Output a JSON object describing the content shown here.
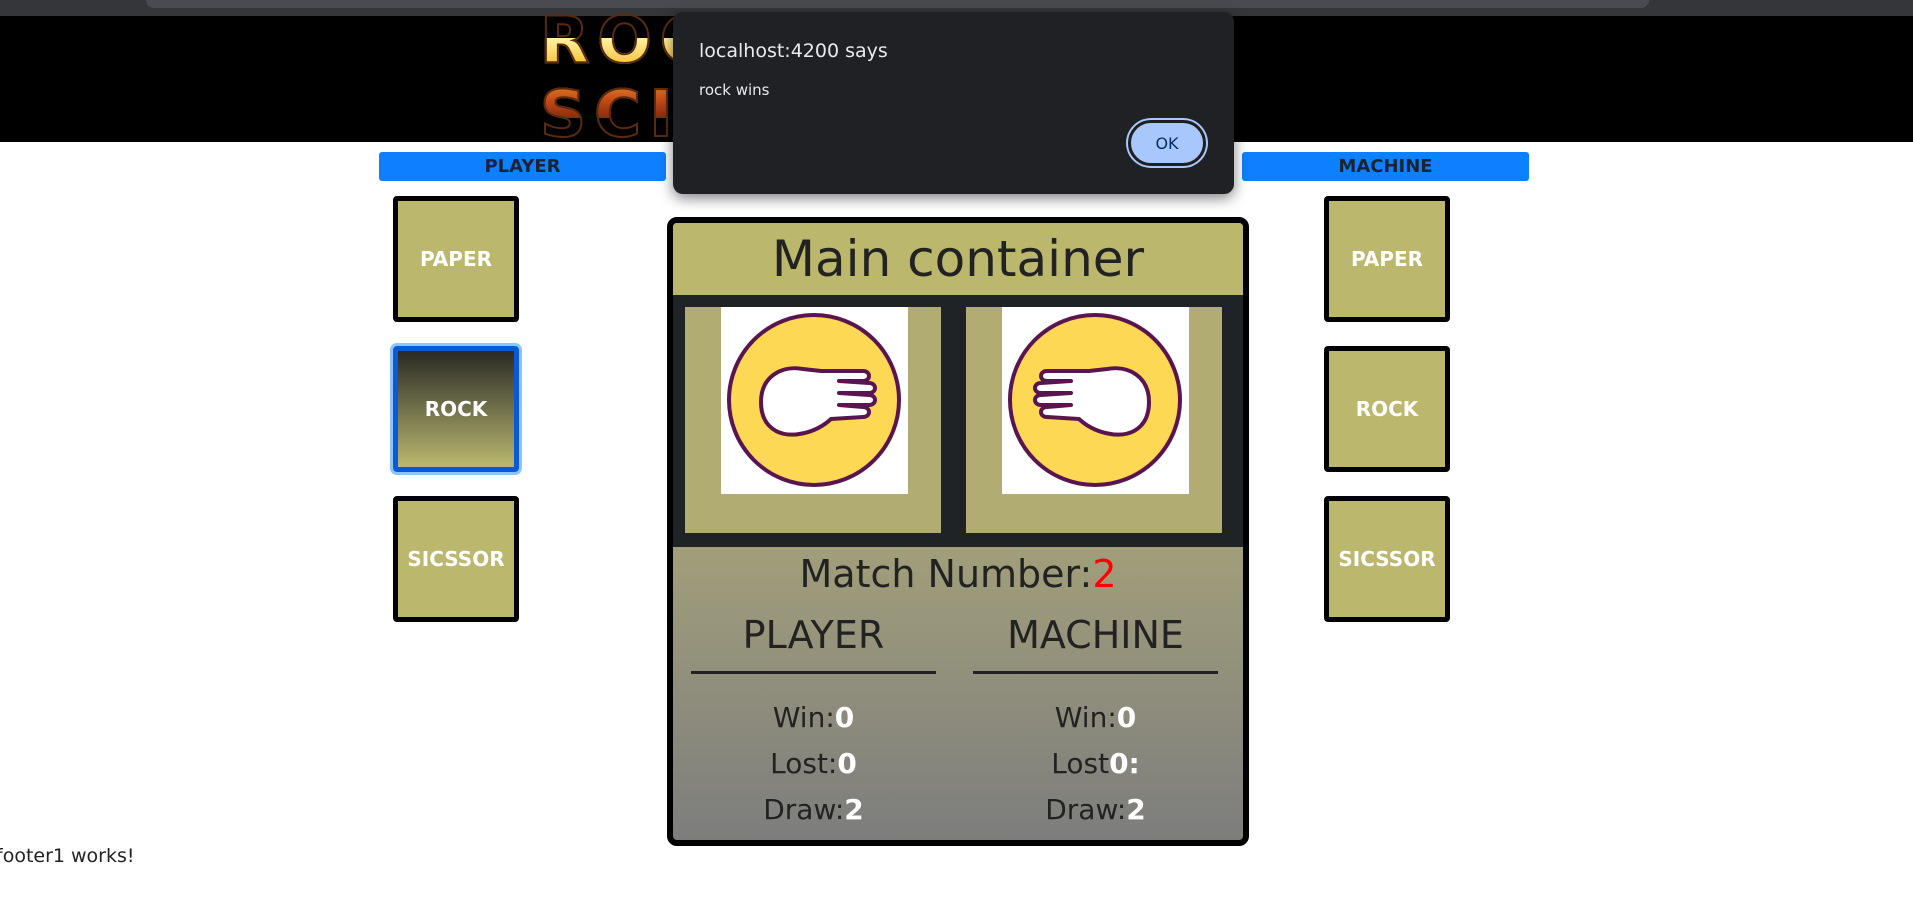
{
  "header": {
    "logo_text": "ROCK PAPER SCISSOR"
  },
  "player_panel": {
    "label": "PLAYER",
    "choices": [
      "PAPER",
      "ROCK",
      "SICSSOR"
    ],
    "selected": "ROCK"
  },
  "machine_panel": {
    "label": "MACHINE",
    "choices": [
      "PAPER",
      "ROCK",
      "SICSSOR"
    ]
  },
  "main": {
    "title": "Main container",
    "player_hand_icon": "paper-hand-icon",
    "machine_hand_icon": "paper-hand-icon",
    "match_label": "Match Number:",
    "match_number": "2",
    "player": {
      "heading": "PLAYER",
      "win_label": "Win:",
      "win": "0",
      "lost_label": "Lost:",
      "lost": "0",
      "draw_label": "Draw:",
      "draw": "2"
    },
    "machine": {
      "heading": "MACHINE",
      "win_label": "Win:",
      "win": "0",
      "lost_label": "Lost",
      "lost": "0:",
      "draw_label": "Draw:",
      "draw": "2"
    }
  },
  "footer": {
    "text": "footer1 works!"
  },
  "dialog": {
    "title": "localhost:4200 says",
    "message": "rock wins",
    "ok_label": "OK"
  },
  "colors": {
    "accent_blue": "#0d80ff",
    "tile": "#bbb86e",
    "match_number": "#ff0000",
    "dialog_bg": "#202124",
    "ok_button": "#a8c7fa"
  }
}
